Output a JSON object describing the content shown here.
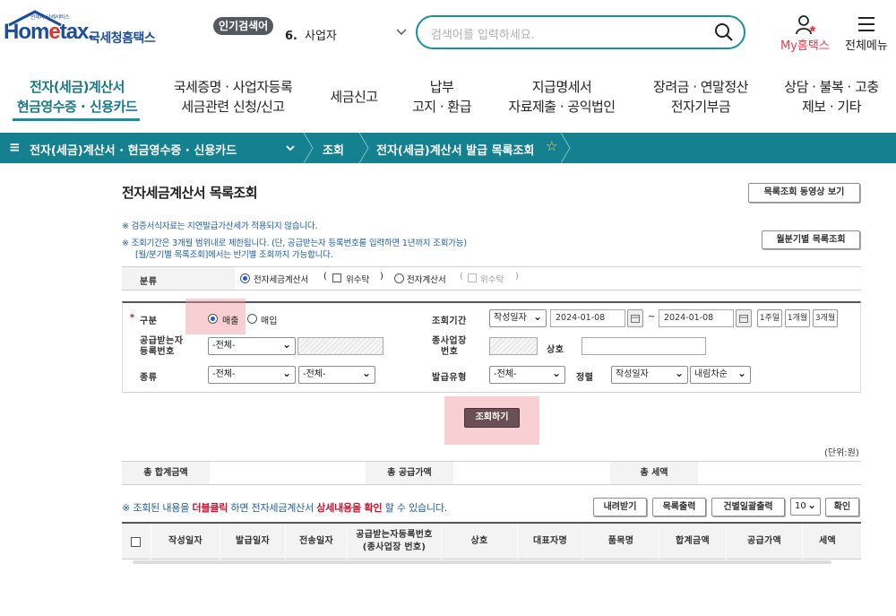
{
  "header": {
    "logo_sub": "언제나 납세서비스",
    "logo_text_a": "Hom",
    "logo_text_e": "e",
    "logo_text_b": "tax.",
    "logo_kr": "국세청홈택스",
    "popular_badge": "인기검색어",
    "popular_rank": "6.",
    "popular_term": "사업자",
    "search_placeholder": "검색어를 입력하세요.",
    "my_label": "My홈택스",
    "menu_label": "전체메뉴"
  },
  "nav": [
    {
      "line1": "전자(세금)계산서",
      "line2": "현금영수증 · 신용카드"
    },
    {
      "line1": "국세증명 · 사업자등록",
      "line2": "세금관련 신청/신고"
    },
    {
      "line1": "세금신고",
      "line2": ""
    },
    {
      "line1": "납부",
      "line2": "고지 · 환급"
    },
    {
      "line1": "지급명세서",
      "line2": "자료제출 · 공익법인"
    },
    {
      "line1": "장려금 · 연말정산",
      "line2": "전자기부금"
    },
    {
      "line1": "상담 · 불복 · 고충",
      "line2": "제보 · 기타"
    }
  ],
  "breadcrumb": {
    "menu_icon": "≡",
    "section": "전자(세금)계산서 · 현금영수증 · 신용카드",
    "level2": "조회",
    "level3": "전자(세금)계산서 발급 목록조회",
    "favorite_icon": "☆"
  },
  "page": {
    "title": "전자세금계산서 목록조회",
    "video_button": "목록조회 동영상 보기",
    "note1": "※ 검증서식자료는 지연발급가산세가 적용되지 않습니다.",
    "note2": "※ 조회기간은 3개월 범위내로 제한됩니다. (단, 공급받는자 등록번호를 입력하면 1년까지 조회가능)",
    "note3": "[월/분기별 목록조회]에서는 반기별 조회까지 가능합니다.",
    "monthly_button": "월분기별 목록조회"
  },
  "classification": {
    "label": "분류",
    "opt1": "전자세금계산서",
    "opt1_sub": "위수탁",
    "opt2": "전자계산서",
    "opt2_sub": "위수탁"
  },
  "form": {
    "required_mark": "*",
    "type_label": "구분",
    "type_sales": "매출",
    "type_purchase": "매입",
    "period_label": "조회기간",
    "period_type": "작성일자",
    "date_from": "2024-01-08",
    "date_to": "2024-01-08",
    "tilde": "~",
    "btn_1week": "1주일",
    "btn_1month": "1개월",
    "btn_3month": "3개월",
    "recipient_label_1": "공급받는자",
    "recipient_label_2": "등록번호",
    "recipient_select": "-전체-",
    "branch_label_1": "종사업장",
    "branch_label_2": "번호",
    "company_label": "상호",
    "kind_label": "종류",
    "kind_select1": "-전체-",
    "kind_select2": "-전체-",
    "issue_type_label": "발급유형",
    "issue_type_select": "-전체-",
    "sort_label": "정렬",
    "sort_field": "작성일자",
    "sort_order": "내림차순",
    "search_button": "조회하기"
  },
  "totals": {
    "unit": "(단위:원)",
    "total_amount_label": "총 합계금액",
    "total_supply_label": "총 공급가액",
    "total_tax_label": "총 세액"
  },
  "list": {
    "note_a": "※ 조회된 내용을 ",
    "note_b": "더블클릭",
    "note_c": " 하면 전자세금계산서 ",
    "note_d": "상세내용을 확인",
    "note_e": " 할 수 있습니다.",
    "download_button": "내려받기",
    "print_button": "목록출력",
    "bulk_print_button": "건별일괄출력",
    "page_size": "10",
    "confirm_button": "확인",
    "columns": [
      "작성일자",
      "발급일자",
      "전송일자",
      "공급받는자등록번호",
      "(종사업장 번호)",
      "상호",
      "대표자명",
      "품목명",
      "합계금액",
      "공급가액",
      "세액"
    ]
  },
  "colors": {
    "brand_teal": "#15808f",
    "logo_blue": "#1c4e9b",
    "highlight": "#f0969f",
    "emphasis_red": "#d0102a"
  }
}
